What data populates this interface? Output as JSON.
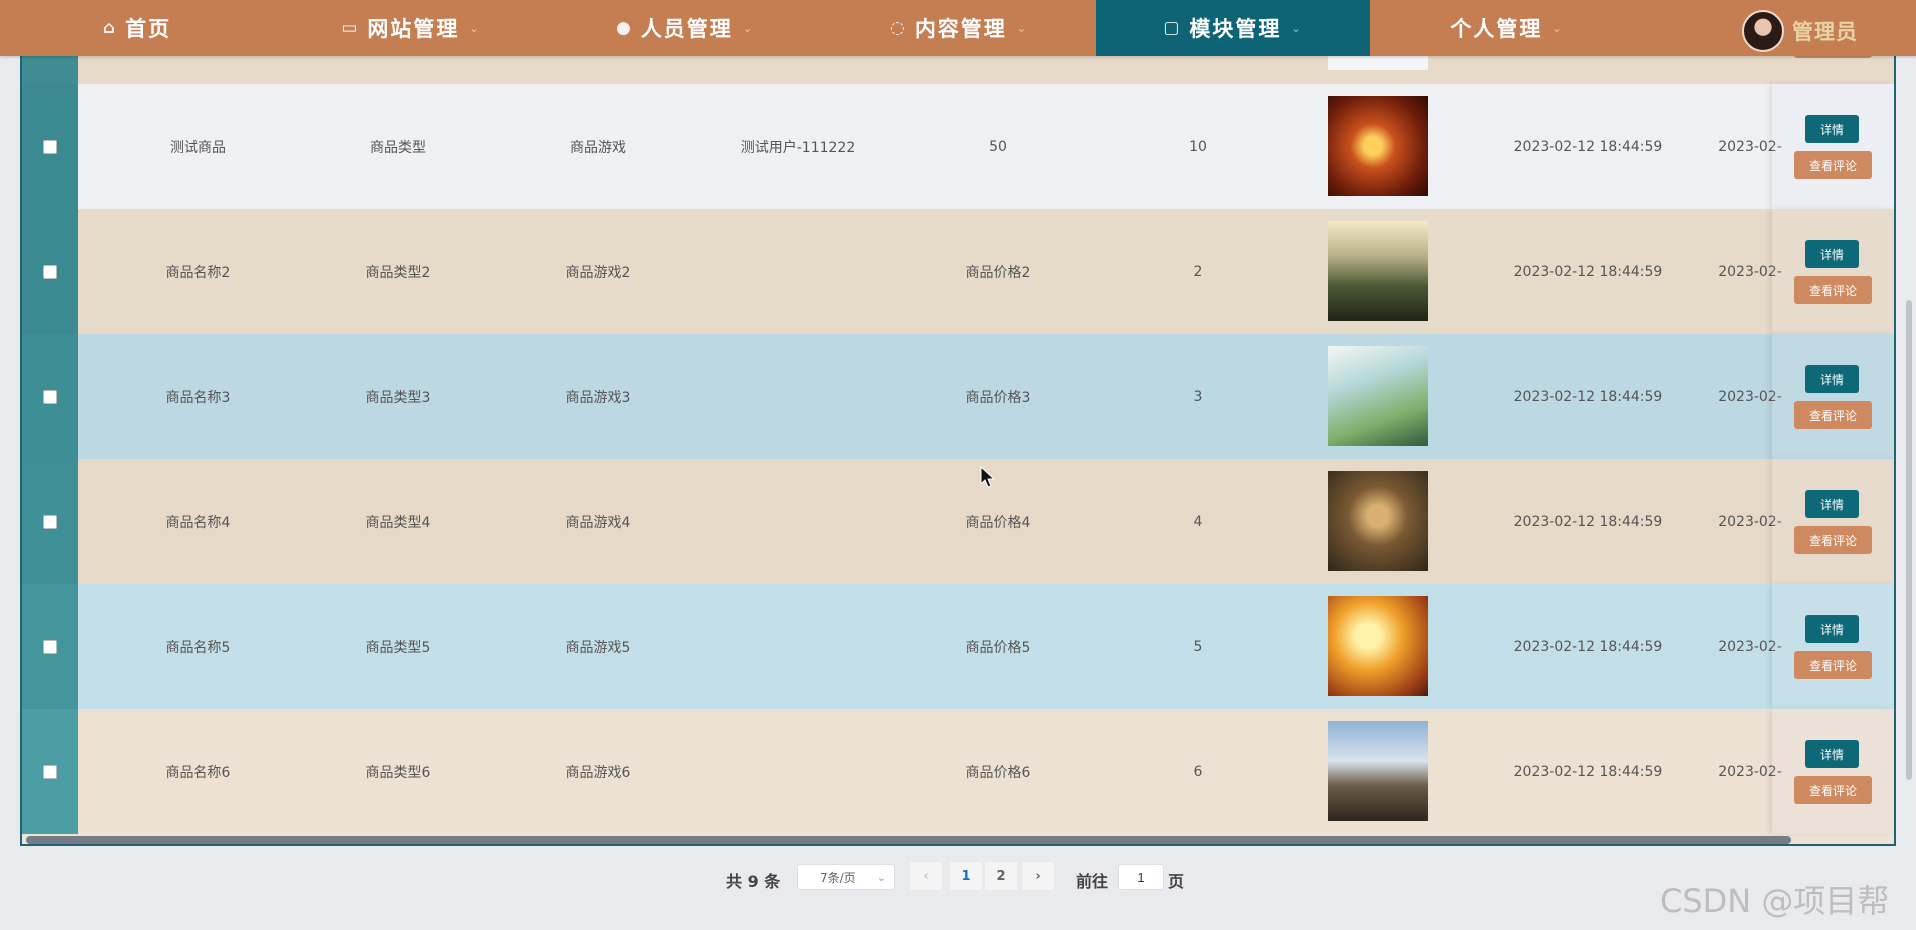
{
  "nav": {
    "items": [
      {
        "label": "首页",
        "icon": "home-icon"
      },
      {
        "label": "网站管理",
        "icon": "monitor-icon"
      },
      {
        "label": "人员管理",
        "icon": "person-icon"
      },
      {
        "label": "内容管理",
        "icon": "chat-icon"
      },
      {
        "label": "模块管理",
        "icon": "module-icon"
      },
      {
        "label": "个人管理",
        "icon": ""
      }
    ],
    "active_index": 4,
    "user_name": "管理员",
    "colors": {
      "bar": "#c47e52",
      "active": "#0e6474"
    }
  },
  "table": {
    "rows": [
      {
        "name": "测试商品",
        "type": "商品类型",
        "game": "商品游戏",
        "user": "测试用户-111222",
        "price": "50",
        "stock": "10",
        "image": "game-art-warrior-fire",
        "created": "2023-02-12 18:44:59",
        "updated": "2023-02-"
      },
      {
        "name": "商品名称2",
        "type": "商品类型2",
        "game": "商品游戏2",
        "user": "",
        "price": "商品价格2",
        "stock": "2",
        "image": "game-art-landscape-sunset",
        "created": "2023-02-12 18:44:59",
        "updated": "2023-02-"
      },
      {
        "name": "商品名称3",
        "type": "商品类型3",
        "game": "商品游戏3",
        "user": "",
        "price": "商品价格3",
        "stock": "3",
        "image": "game-art-knight-sky",
        "created": "2023-02-12 18:44:59",
        "updated": "2023-02-"
      },
      {
        "name": "商品名称4",
        "type": "商品类型4",
        "game": "商品游戏4",
        "user": "",
        "price": "商品价格4",
        "stock": "4",
        "image": "game-art-beast-battle",
        "created": "2023-02-12 18:44:59",
        "updated": "2023-02-"
      },
      {
        "name": "商品名称5",
        "type": "商品类型5",
        "game": "商品游戏5",
        "user": "",
        "price": "商品价格5",
        "stock": "5",
        "image": "game-art-heroes-explosion",
        "created": "2023-02-12 18:44:59",
        "updated": "2023-02-"
      },
      {
        "name": "商品名称6",
        "type": "商品类型6",
        "game": "商品游戏6",
        "user": "",
        "price": "商品价格6",
        "stock": "6",
        "image": "game-art-soldiers-squad",
        "created": "2023-02-12 18:44:59",
        "updated": "2023-02-"
      }
    ],
    "detail_label": "详情",
    "comment_label": "查看评论"
  },
  "pagination": {
    "total_label": "共 9 条",
    "page_size": "7条/页",
    "prev_icon": "chevron-left-icon",
    "next_icon": "chevron-right-icon",
    "pages": [
      "1",
      "2"
    ],
    "current": "1",
    "goto_label": "前往",
    "goto_value": "1",
    "page_suffix": "页"
  },
  "watermark": "CSDN @项目帮"
}
